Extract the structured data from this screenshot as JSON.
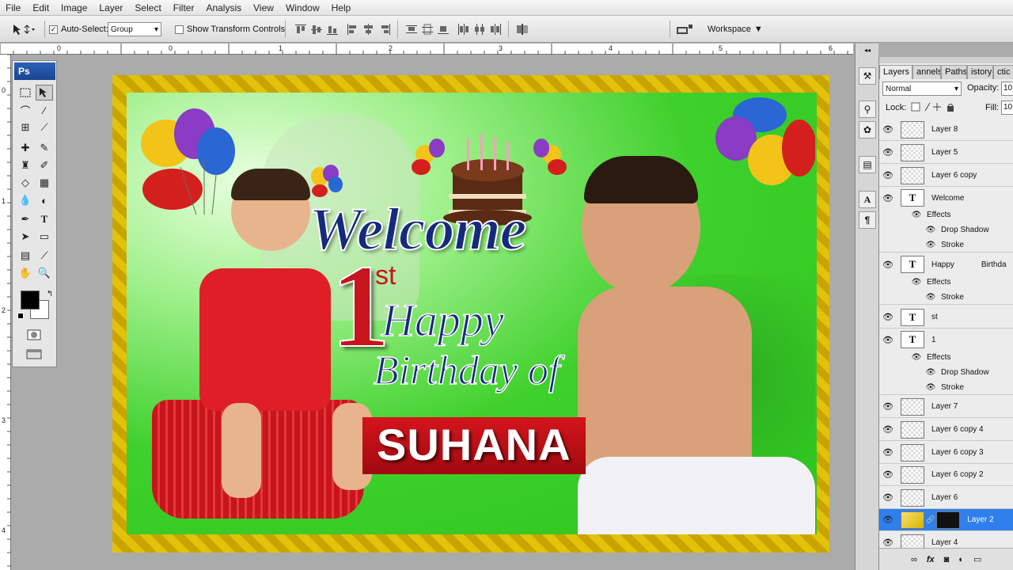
{
  "menu": [
    "File",
    "Edit",
    "Image",
    "Layer",
    "Select",
    "Filter",
    "Analysis",
    "View",
    "Window",
    "Help"
  ],
  "options": {
    "auto_select_label": "Auto-Select:",
    "auto_select_value": "Group",
    "show_transform_label": "Show Transform Controls",
    "workspace_label": "Workspace"
  },
  "rulers": {
    "top": [
      "0",
      "0",
      "1",
      "2",
      "3",
      "4",
      "5",
      "6"
    ],
    "left": [
      "0",
      "1",
      "2",
      "3",
      "4"
    ]
  },
  "tools": {
    "logo": "Ps"
  },
  "banner": {
    "welcome": "Welcome",
    "one": "1",
    "st": "st",
    "happy": "Happy",
    "birthday_of": "Birthday of",
    "name": "SUHANA"
  },
  "panel": {
    "tabs": [
      "Layers",
      "annels",
      "Paths",
      "istory",
      "ctic"
    ],
    "blend_mode": "Normal",
    "opacity_label": "Opacity:",
    "opacity_value": "10",
    "lock_label": "Lock:",
    "fill_label": "Fill:",
    "fill_value": "10",
    "layers": [
      {
        "name": "Layer 8",
        "kind": "image"
      },
      {
        "name": "Layer 5",
        "kind": "image"
      },
      {
        "name": "Layer 6 copy",
        "kind": "image"
      },
      {
        "name": "Welcome",
        "kind": "text"
      },
      {
        "name": "Effects",
        "kind": "fx"
      },
      {
        "name": "Drop Shadow",
        "kind": "effect"
      },
      {
        "name": "Stroke",
        "kind": "effect"
      },
      {
        "name": "Happy",
        "extra": "Birthda",
        "kind": "text"
      },
      {
        "name": "Effects",
        "kind": "fx"
      },
      {
        "name": "Stroke",
        "kind": "effect"
      },
      {
        "name": "st",
        "kind": "text"
      },
      {
        "name": "1",
        "kind": "text"
      },
      {
        "name": "Effects",
        "kind": "fx"
      },
      {
        "name": "Drop Shadow",
        "kind": "effect"
      },
      {
        "name": "Stroke",
        "kind": "effect"
      },
      {
        "name": "Layer 7",
        "kind": "image"
      },
      {
        "name": "Layer 6 copy 4",
        "kind": "image"
      },
      {
        "name": "Layer 6 copy 3",
        "kind": "image"
      },
      {
        "name": "Layer 6 copy 2",
        "kind": "image"
      },
      {
        "name": "Layer 6",
        "kind": "image"
      },
      {
        "name": "Layer 2",
        "kind": "image-selected"
      },
      {
        "name": "Layer 4",
        "kind": "image"
      }
    ]
  },
  "colors": {
    "selection": "#2f80ed",
    "banner_green": "#2bc41c",
    "ribbon_red": "#c8141c",
    "text_navy": "#142a7c"
  }
}
